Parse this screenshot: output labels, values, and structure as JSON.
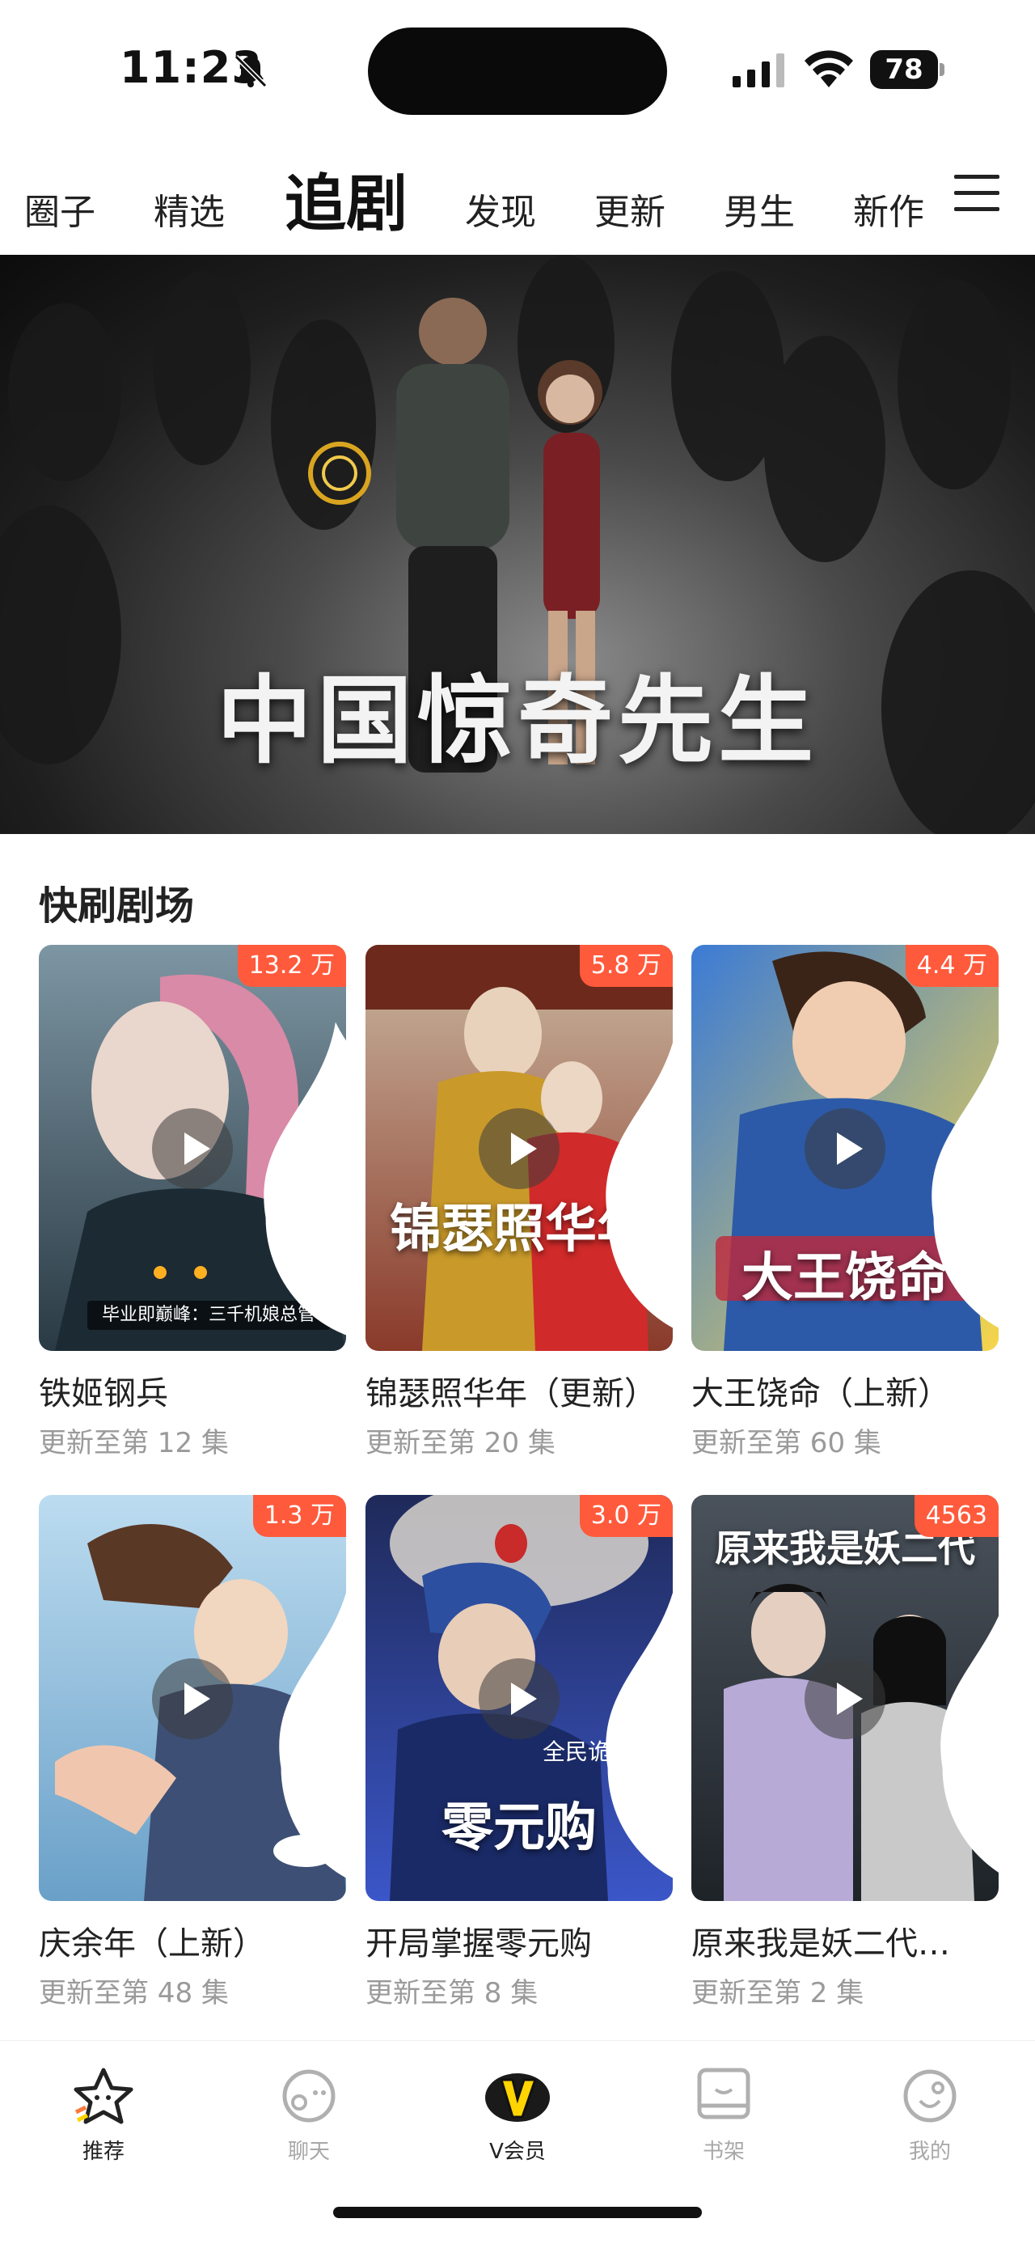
{
  "status_bar": {
    "time": "11:23",
    "battery": "78"
  },
  "top_tabs": [
    "圈子",
    "精选",
    "追剧",
    "发现",
    "更新",
    "男生",
    "新作"
  ],
  "active_tab": "追剧",
  "banner": {
    "title": "中国惊奇先生",
    "dot_count": 7,
    "active_dot": 0
  },
  "section": {
    "title": "快刷剧场"
  },
  "cards": [
    {
      "title": "铁姬钢兵",
      "subtitle": "更新至第 12 集",
      "heat": "13.2 万",
      "caption": "",
      "strip": "毕业即巅峰：三千机娘总管"
    },
    {
      "title": "锦瑟照华年（更新）",
      "subtitle": "更新至第 20 集",
      "heat": "5.8 万",
      "caption": "锦瑟照华年",
      "strip": ""
    },
    {
      "title": "大王饶命（上新）",
      "subtitle": "更新至第 60 集",
      "heat": "4.4 万",
      "caption": "大王饶命",
      "strip": ""
    },
    {
      "title": "庆余年（上新）",
      "subtitle": "更新至第 48 集",
      "heat": "1.3 万",
      "caption": "",
      "strip": ""
    },
    {
      "title": "开局掌握零元购",
      "subtitle": "更新至第 8 集",
      "heat": "3.0 万",
      "caption": "零元购",
      "strip": "全民诡异"
    },
    {
      "title": "原来我是妖二代…",
      "subtitle": "更新至第 2 集",
      "heat": "4563",
      "caption": "原来我是妖二代",
      "strip": ""
    }
  ],
  "bottom_nav": [
    {
      "label": "推荐",
      "icon": "star-icon",
      "active": true
    },
    {
      "label": "聊天",
      "icon": "chat-face-icon",
      "active": false
    },
    {
      "label": "V会员",
      "icon": "vip-v-icon",
      "active": false
    },
    {
      "label": "书架",
      "icon": "bookshelf-icon",
      "active": false
    },
    {
      "label": "我的",
      "icon": "profile-face-icon",
      "active": false
    }
  ],
  "colors": {
    "heat_badge": "#ff5a3c",
    "vip_yellow": "#ffd400",
    "text_primary": "#222222",
    "text_secondary": "#9a9a9a"
  }
}
